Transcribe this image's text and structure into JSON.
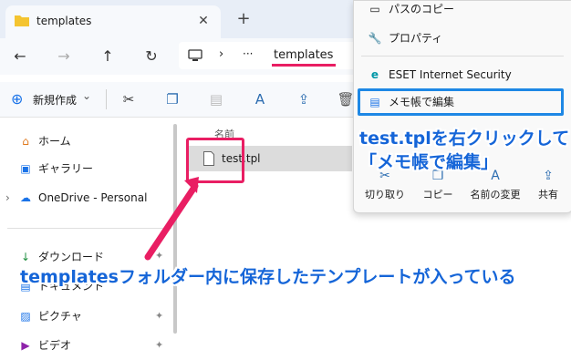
{
  "window": {
    "tab_title": "templates",
    "tab_close": "✕",
    "new_tab": "+"
  },
  "address": {
    "path_last": "templates",
    "ellipsis": "···",
    "separator": "›"
  },
  "toolbar": {
    "new_label": "新規作成",
    "new_chevron": "⌄"
  },
  "sidebar": {
    "items": [
      {
        "label": "ホーム",
        "icon": "home-icon"
      },
      {
        "label": "ギャラリー",
        "icon": "gallery-icon"
      },
      {
        "label": "OneDrive - Personal",
        "icon": "cloud-icon"
      },
      {
        "label": "ダウンロード",
        "icon": "download-icon"
      },
      {
        "label": "ドキュメント",
        "icon": "document-icon"
      },
      {
        "label": "ピクチャ",
        "icon": "picture-icon"
      },
      {
        "label": "ビデオ",
        "icon": "video-icon"
      }
    ]
  },
  "file_list": {
    "column_name": "名前",
    "files": [
      {
        "name": "test.tpl"
      }
    ]
  },
  "context_menu": {
    "items": [
      {
        "label": "パスのコピー",
        "icon": "copy-path-icon"
      },
      {
        "label": "プロパティ",
        "icon": "wrench-icon"
      },
      {
        "label": "ESET Internet Security",
        "icon": "eset-icon"
      },
      {
        "label": "メモ帳で編集",
        "icon": "notepad-icon"
      }
    ],
    "actions": [
      {
        "label": "切り取り",
        "icon": "cut-icon"
      },
      {
        "label": "コピー",
        "icon": "copy-icon"
      },
      {
        "label": "名前の変更",
        "icon": "rename-icon"
      },
      {
        "label": "共有",
        "icon": "share-icon"
      }
    ]
  },
  "annotations": {
    "right_click_line1": "test.tplを右クリックして",
    "right_click_line2": "「メモ帳で編集」",
    "folder_note": "templatesフォルダー内に保存したテンプレートが入っている"
  },
  "colors": {
    "highlight_pink": "#e91e63",
    "highlight_blue": "#1e88e5",
    "callout_blue": "#1565d8",
    "folder_yellow": "#f4c430"
  }
}
